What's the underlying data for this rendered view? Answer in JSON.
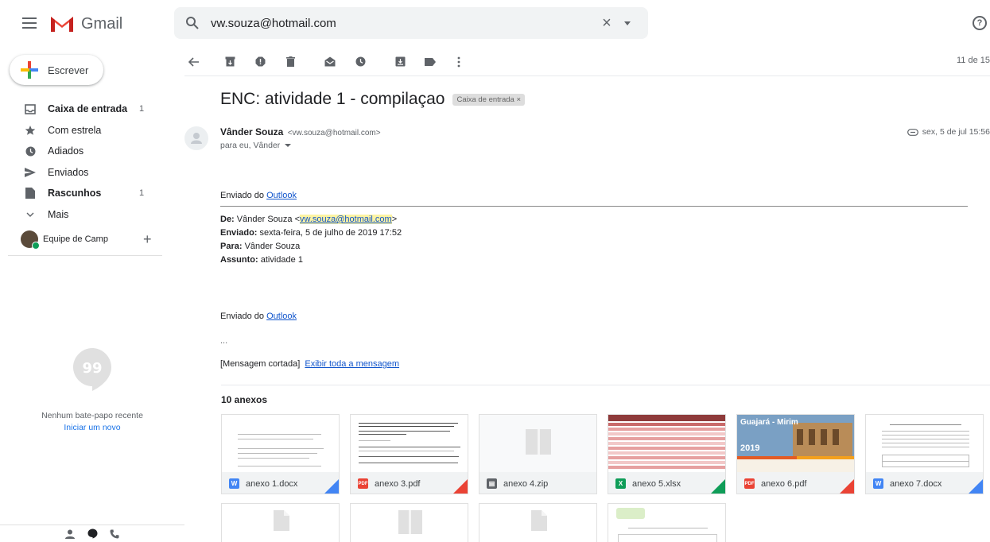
{
  "app": {
    "name": "Gmail"
  },
  "search": {
    "query": "vw.souza@hotmail.com"
  },
  "sidebar": {
    "compose_label": "Escrever",
    "items": [
      {
        "label": "Caixa de entrada",
        "count": "1",
        "bold": true,
        "icon": "inbox-icon"
      },
      {
        "label": "Com estrela",
        "count": "",
        "bold": false,
        "icon": "star-icon"
      },
      {
        "label": "Adiados",
        "count": "",
        "bold": false,
        "icon": "clock-icon"
      },
      {
        "label": "Enviados",
        "count": "",
        "bold": false,
        "icon": "send-icon"
      },
      {
        "label": "Rascunhos",
        "count": "1",
        "bold": true,
        "icon": "draft-icon"
      },
      {
        "label": "Mais",
        "count": "",
        "bold": false,
        "icon": "chevron-down-icon"
      }
    ],
    "hangouts_user": "Equipe de Camp",
    "chat_empty": "Nenhum bate-papo recente",
    "chat_start": "Iniciar um novo"
  },
  "toolbar": {
    "pager": "11 de 15"
  },
  "message": {
    "subject": "ENC: atividade 1 - compilaçao",
    "label": "Caixa de entrada",
    "label_close": "×",
    "sender_name": "Vânder Souza",
    "sender_email": "<vw.souza@hotmail.com>",
    "to": "para eu, Vânder",
    "date": "sex, 5 de jul 15:56",
    "sent_from_1": "Enviado do ",
    "outlook": "Outlook",
    "from_label": "De:",
    "from_value": " Vânder Souza <",
    "from_email": "vw.souza@hotmail.com",
    "from_end": ">",
    "sent_label": "Enviado:",
    "sent_value": " sexta-feira, 5 de julho de 2019 17:52",
    "to_label": "Para:",
    "to_value": " Vânder Souza",
    "subj_label": "Assunto:",
    "subj_value": " atividade 1",
    "ellipsis": "...",
    "clipped": "[Mensagem cortada]",
    "view_all": "Exibir toda a mensagem"
  },
  "attachments": {
    "title": "10 anexos",
    "files": [
      {
        "name": "anexo 1.docx",
        "type": "W",
        "color": "#4285f4"
      },
      {
        "name": "anexo 3.pdf",
        "type": "PDF",
        "color": "#ea4335"
      },
      {
        "name": "anexo 4.zip",
        "type": "zip",
        "color": "#5f6368"
      },
      {
        "name": "anexo 5.xlsx",
        "type": "X",
        "color": "#0f9d58"
      },
      {
        "name": "anexo 6.pdf",
        "type": "PDF",
        "color": "#ea4335"
      },
      {
        "name": "anexo 7.docx",
        "type": "W",
        "color": "#4285f4"
      }
    ],
    "preview_6_title": "Guajará - Mirim",
    "preview_6_year": "2019"
  }
}
